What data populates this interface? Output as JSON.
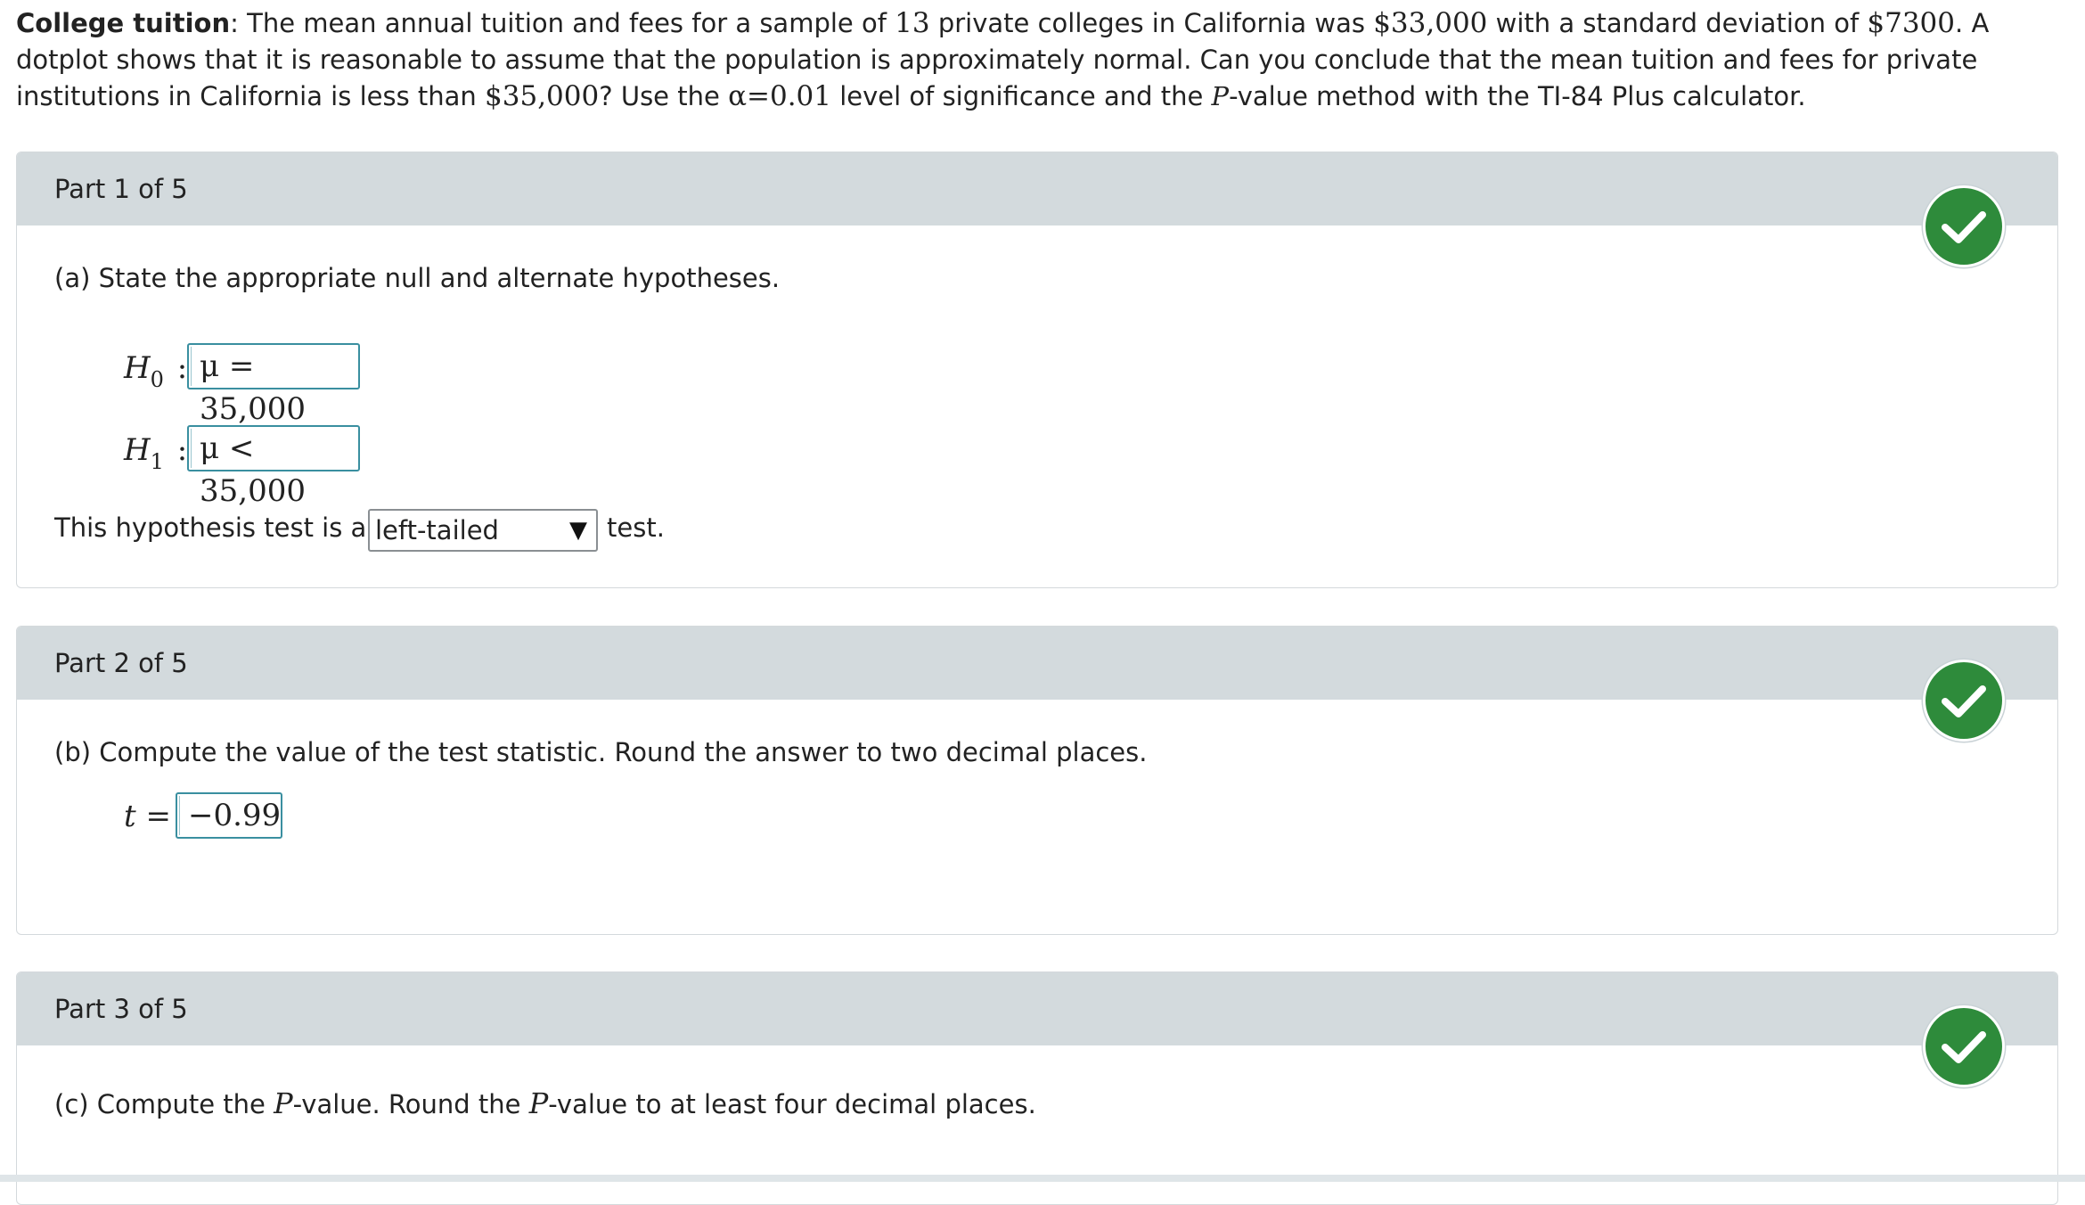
{
  "problem": {
    "title": "College tuition",
    "text_1": ": The mean annual tuition and fees for a sample of ",
    "n": "13",
    "text_2": " private colleges in California was ",
    "mean": "$33,000",
    "text_3": " with a standard deviation of ",
    "sd": "$7300",
    "text_4": ". A dotplot shows that it is reasonable to assume that the population is approximately normal. Can you conclude that the mean tuition and fees for private institutions in California is less than ",
    "mu0": "$35,000",
    "text_5": "? Use the ",
    "alpha": "α=0.01",
    "text_6": " level of significance and the ",
    "p": "P",
    "text_7": "-value method with the TI-84 Plus calculator."
  },
  "parts": [
    {
      "title": "Part 1 of 5",
      "prompt": "(a) State the appropriate null and alternate hypotheses.",
      "h0_label": "H",
      "h0_sub": "0",
      "h1_label": "H",
      "h1_sub": "1",
      "colon": ":",
      "h0_answer": "μ = 35,000",
      "h1_answer": "μ < 35,000",
      "test_text_before": "This hypothesis test is a",
      "test_select_value": "left-tailed",
      "test_text_after": "test."
    },
    {
      "title": "Part 2 of 5",
      "prompt": "(b) Compute the value of the test statistic. Round the answer to two decimal places.",
      "t_label": "t =",
      "t_answer": "−0.99"
    },
    {
      "title": "Part 3 of 5",
      "prompt_1": "(c) Compute the ",
      "prompt_p1": "P",
      "prompt_2": "-value. Round the ",
      "prompt_p2": "P",
      "prompt_3": "-value to at least four decimal places."
    }
  ],
  "colors": {
    "header_bg": "#d3dadd",
    "check_green": "#2e8b3b",
    "answer_border": "#3a8fa0"
  },
  "icons": {
    "status": "checkmark-icon",
    "dropdown": "triangle-down-icon"
  }
}
